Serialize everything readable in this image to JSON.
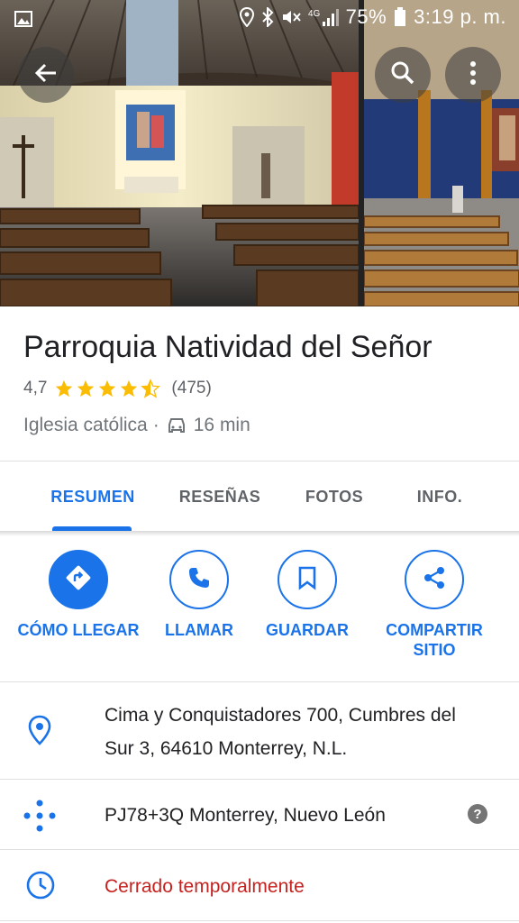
{
  "status_bar": {
    "battery": "75%",
    "time": "3:19 p. m."
  },
  "place": {
    "name": "Parroquia Natividad del Señor",
    "rating": "4,7",
    "rating_value": 4.7,
    "reviews": "(475)",
    "category": "Iglesia católica",
    "separator": "·",
    "travel_time": "16 min"
  },
  "tabs": [
    {
      "label": "RESUMEN",
      "active": true
    },
    {
      "label": "RESEÑAS",
      "active": false
    },
    {
      "label": "FOTOS",
      "active": false
    },
    {
      "label": "INFO.",
      "active": false
    }
  ],
  "actions": [
    {
      "label": "CÓMO LLEGAR",
      "icon": "directions-icon"
    },
    {
      "label": "LLAMAR",
      "icon": "phone-icon"
    },
    {
      "label": "GUARDAR",
      "icon": "bookmark-icon"
    },
    {
      "label": "COMPARTIR SITIO",
      "icon": "share-icon"
    }
  ],
  "info": {
    "address": "Cima y Conquistadores 700, Cumbres del Sur 3, 64610 Monterrey, N.L.",
    "plus_code": "PJ78+3Q Monterrey, Nuevo León",
    "hours": "Cerrado temporalmente"
  },
  "colors": {
    "accent": "#1a73e8",
    "star": "#fbbc04",
    "closed": "#c5221f"
  }
}
